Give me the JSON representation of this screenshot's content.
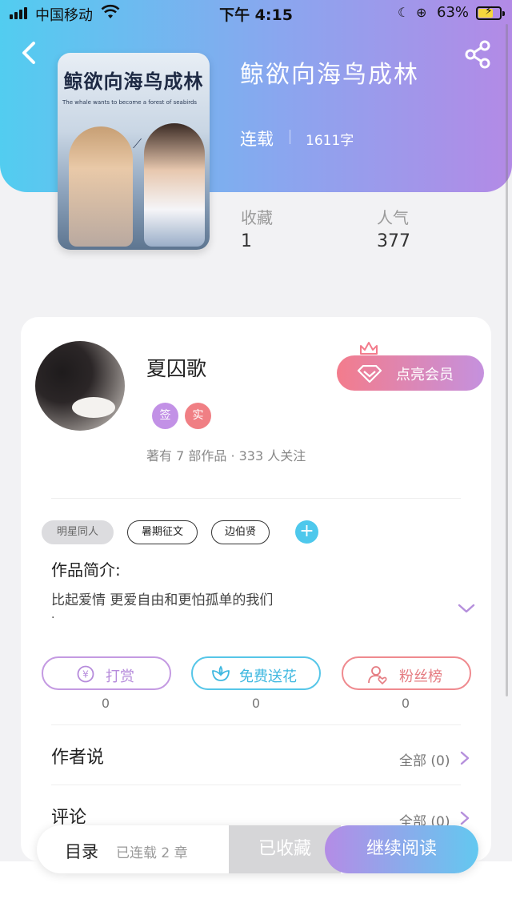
{
  "status_bar": {
    "carrier": "中国移动",
    "time": "下午 4:15",
    "battery": "63%"
  },
  "book": {
    "cover_title": "鲸欲向海鸟成林",
    "cover_subtitle": "The whale wants to become a forest of seabirds",
    "title": "鲸欲向海鸟成林",
    "status": "连载",
    "word_count": "1611字",
    "stats": {
      "favorites_label": "收藏",
      "favorites_value": "1",
      "popularity_label": "人气",
      "popularity_value": "377"
    }
  },
  "author": {
    "name": "夏囚歌",
    "badge_signed": "签",
    "badge_verified": "实",
    "meta": "著有 7 部作品 · 333 人关注",
    "vip_button": "点亮会员"
  },
  "tags": [
    "明星同人",
    "暑期征文",
    "边伯贤"
  ],
  "tag_add": "+",
  "synopsis": {
    "title": "作品简介:",
    "text": "比起爱情 更爱自由和更怕孤单的我们",
    "trailing": "."
  },
  "actions": [
    {
      "label": "打赏",
      "count": "0",
      "icon": "yen-icon"
    },
    {
      "label": "免费送花",
      "count": "0",
      "icon": "flower-icon"
    },
    {
      "label": "粉丝榜",
      "count": "0",
      "icon": "fans-icon"
    }
  ],
  "author_says": {
    "title": "作者说",
    "all": "全部 (0)"
  },
  "comments": {
    "title": "评论",
    "all": "全部 (0)"
  },
  "bottom_bar": {
    "toc": "目录",
    "chapters": "已连载 2 章",
    "collected": "已收藏",
    "continue": "继续阅读"
  },
  "colors": {
    "header_gradient_start": "#52cdf0",
    "header_gradient_end": "#b38ae6",
    "vip_gradient_start": "#f37c8c",
    "vip_gradient_end": "#c591de",
    "tag_add": "#4ec8ec"
  }
}
